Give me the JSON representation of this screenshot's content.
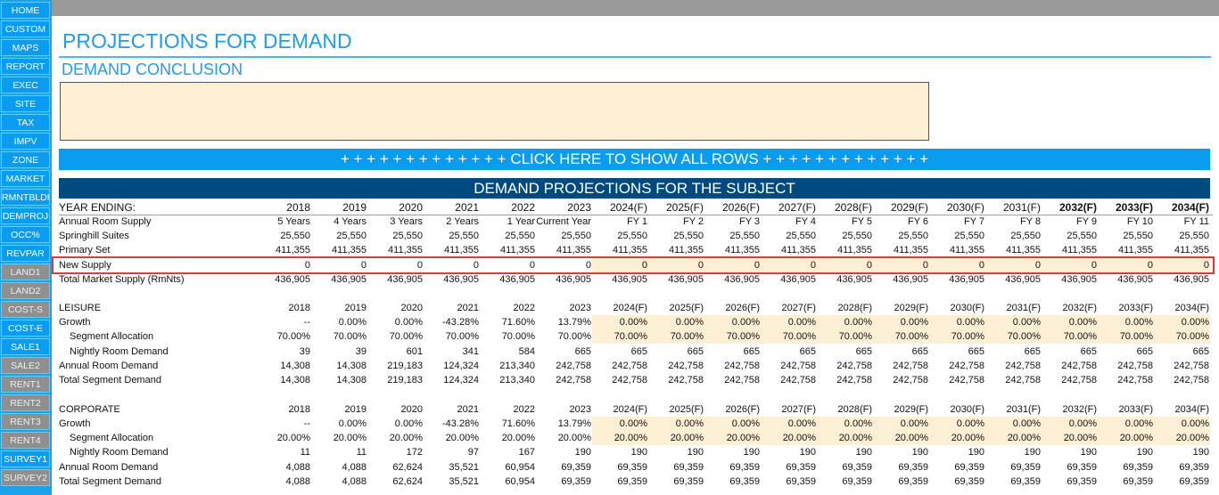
{
  "sidebar": [
    {
      "label": "HOME",
      "gray": false
    },
    {
      "label": "CUSTOM",
      "gray": false
    },
    {
      "label": "MAPS",
      "gray": false
    },
    {
      "label": "REPORT",
      "gray": false
    },
    {
      "label": "EXEC",
      "gray": false
    },
    {
      "label": "SITE",
      "gray": false
    },
    {
      "label": "TAX",
      "gray": false
    },
    {
      "label": "IMPV",
      "gray": false
    },
    {
      "label": "ZONE",
      "gray": false
    },
    {
      "label": "MARKET",
      "gray": false
    },
    {
      "label": "RMNTBLDR",
      "gray": false
    },
    {
      "label": "DEMPROJ",
      "gray": false
    },
    {
      "label": "OCC%",
      "gray": false
    },
    {
      "label": "REVPAR",
      "gray": false
    },
    {
      "label": "LAND1",
      "gray": true
    },
    {
      "label": "LAND2",
      "gray": true
    },
    {
      "label": "COST-S",
      "gray": true
    },
    {
      "label": "COST-E",
      "gray": false
    },
    {
      "label": "SALE1",
      "gray": false
    },
    {
      "label": "SALE2",
      "gray": true
    },
    {
      "label": "RENT1",
      "gray": true
    },
    {
      "label": "RENT2",
      "gray": true
    },
    {
      "label": "RENT3",
      "gray": true
    },
    {
      "label": "RENT4",
      "gray": true
    },
    {
      "label": "SURVEY1",
      "gray": false
    },
    {
      "label": "SURVEY2",
      "gray": true
    }
  ],
  "title": "PROJECTIONS FOR DEMAND",
  "subtitle": "DEMAND CONCLUSION",
  "conclusion_text": "",
  "show_rows_label": "+ + + + + + + + + + + + + CLICK HERE TO SHOW ALL ROWS + + + + + + + + + + + + +",
  "table_title": "DEMAND PROJECTIONS FOR THE SUBJECT",
  "rows": [
    {
      "label": "YEAR ENDING:",
      "type": "hdr",
      "values": [
        "2018",
        "2019",
        "2020",
        "2021",
        "2022",
        "2023",
        "2024(F)",
        "2025(F)",
        "2026(F)",
        "2027(F)",
        "2028(F)",
        "2029(F)",
        "2030(F)",
        "2031(F)",
        "2032(F)",
        "2033(F)",
        "2034(F)"
      ]
    },
    {
      "label": "Annual Room Supply",
      "values": [
        "5 Years",
        "4 Years",
        "3 Years",
        "2 Years",
        "1 Year",
        "Current Year",
        "FY 1",
        "FY 2",
        "FY 3",
        "FY 4",
        "FY 5",
        "FY 6",
        "FY 7",
        "FY 8",
        "FY 9",
        "FY 10",
        "FY 11"
      ]
    },
    {
      "label": "Springhill Suites",
      "values": [
        "25,550",
        "25,550",
        "25,550",
        "25,550",
        "25,550",
        "25,550",
        "25,550",
        "25,550",
        "25,550",
        "25,550",
        "25,550",
        "25,550",
        "25,550",
        "25,550",
        "25,550",
        "25,550",
        "25,550"
      ]
    },
    {
      "label": "Primary Set",
      "values": [
        "411,355",
        "411,355",
        "411,355",
        "411,355",
        "411,355",
        "411,355",
        "411,355",
        "411,355",
        "411,355",
        "411,355",
        "411,355",
        "411,355",
        "411,355",
        "411,355",
        "411,355",
        "411,355",
        "411,355"
      ]
    },
    {
      "label": "New Supply",
      "hl": true,
      "values": [
        "0",
        "0",
        "0",
        "0",
        "0",
        "0",
        "0",
        "0",
        "0",
        "0",
        "0",
        "0",
        "0",
        "0",
        "0",
        "0",
        "0"
      ]
    },
    {
      "label": "Total Market Supply (RmNts)",
      "values": [
        "436,905",
        "436,905",
        "436,905",
        "436,905",
        "436,905",
        "436,905",
        "436,905",
        "436,905",
        "436,905",
        "436,905",
        "436,905",
        "436,905",
        "436,905",
        "436,905",
        "436,905",
        "436,905",
        "436,905"
      ]
    },
    {
      "label": "LEISURE",
      "values": [
        "2018",
        "2019",
        "2020",
        "2021",
        "2022",
        "2023",
        "2024(F)",
        "2025(F)",
        "2026(F)",
        "2027(F)",
        "2028(F)",
        "2029(F)",
        "2030(F)",
        "2031(F)",
        "2032(F)",
        "2033(F)",
        "2034(F)"
      ]
    },
    {
      "label": "Growth",
      "hl": true,
      "values": [
        "--",
        "0.00%",
        "0.00%",
        "-43.28%",
        "71.60%",
        "13.79%",
        "0.00%",
        "0.00%",
        "0.00%",
        "0.00%",
        "0.00%",
        "0.00%",
        "0.00%",
        "0.00%",
        "0.00%",
        "0.00%",
        "0.00%"
      ]
    },
    {
      "label": "Segment Allocation",
      "ind": true,
      "hl": true,
      "values": [
        "70.00%",
        "70.00%",
        "70.00%",
        "70.00%",
        "70.00%",
        "70.00%",
        "70.00%",
        "70.00%",
        "70.00%",
        "70.00%",
        "70.00%",
        "70.00%",
        "70.00%",
        "70.00%",
        "70.00%",
        "70.00%",
        "70.00%"
      ]
    },
    {
      "label": "Nightly Room Demand",
      "ind": true,
      "values": [
        "39",
        "39",
        "601",
        "341",
        "584",
        "665",
        "665",
        "665",
        "665",
        "665",
        "665",
        "665",
        "665",
        "665",
        "665",
        "665",
        "665"
      ]
    },
    {
      "label": "Annual Room Demand",
      "values": [
        "14,308",
        "14,308",
        "219,183",
        "124,324",
        "213,340",
        "242,758",
        "242,758",
        "242,758",
        "242,758",
        "242,758",
        "242,758",
        "242,758",
        "242,758",
        "242,758",
        "242,758",
        "242,758",
        "242,758"
      ]
    },
    {
      "label": "Total Segment Demand",
      "values": [
        "14,308",
        "14,308",
        "219,183",
        "124,324",
        "213,340",
        "242,758",
        "242,758",
        "242,758",
        "242,758",
        "242,758",
        "242,758",
        "242,758",
        "242,758",
        "242,758",
        "242,758",
        "242,758",
        "242,758"
      ]
    },
    {
      "label": "CORPORATE",
      "values": [
        "2018",
        "2019",
        "2020",
        "2021",
        "2022",
        "2023",
        "2024(F)",
        "2025(F)",
        "2026(F)",
        "2027(F)",
        "2028(F)",
        "2029(F)",
        "2030(F)",
        "2031(F)",
        "2032(F)",
        "2033(F)",
        "2034(F)"
      ]
    },
    {
      "label": "Growth",
      "hl": true,
      "values": [
        "--",
        "0.00%",
        "0.00%",
        "-43.28%",
        "71.60%",
        "13.79%",
        "0.00%",
        "0.00%",
        "0.00%",
        "0.00%",
        "0.00%",
        "0.00%",
        "0.00%",
        "0.00%",
        "0.00%",
        "0.00%",
        "0.00%"
      ]
    },
    {
      "label": "Segment Allocation",
      "ind": true,
      "hl": true,
      "values": [
        "20.00%",
        "20.00%",
        "20.00%",
        "20.00%",
        "20.00%",
        "20.00%",
        "20.00%",
        "20.00%",
        "20.00%",
        "20.00%",
        "20.00%",
        "20.00%",
        "20.00%",
        "20.00%",
        "20.00%",
        "20.00%",
        "20.00%"
      ]
    },
    {
      "label": "Nightly Room Demand",
      "ind": true,
      "values": [
        "11",
        "11",
        "172",
        "97",
        "167",
        "190",
        "190",
        "190",
        "190",
        "190",
        "190",
        "190",
        "190",
        "190",
        "190",
        "190",
        "190"
      ]
    },
    {
      "label": "Annual Room Demand",
      "values": [
        "4,088",
        "4,088",
        "62,624",
        "35,521",
        "60,954",
        "69,359",
        "69,359",
        "69,359",
        "69,359",
        "69,359",
        "69,359",
        "69,359",
        "69,359",
        "69,359",
        "69,359",
        "69,359",
        "69,359"
      ]
    },
    {
      "label": "Total Segment Demand",
      "values": [
        "4,088",
        "4,088",
        "62,624",
        "35,521",
        "60,954",
        "69,359",
        "69,359",
        "69,359",
        "69,359",
        "69,359",
        "69,359",
        "69,359",
        "69,359",
        "69,359",
        "69,359",
        "69,359",
        "69,359"
      ]
    }
  ]
}
